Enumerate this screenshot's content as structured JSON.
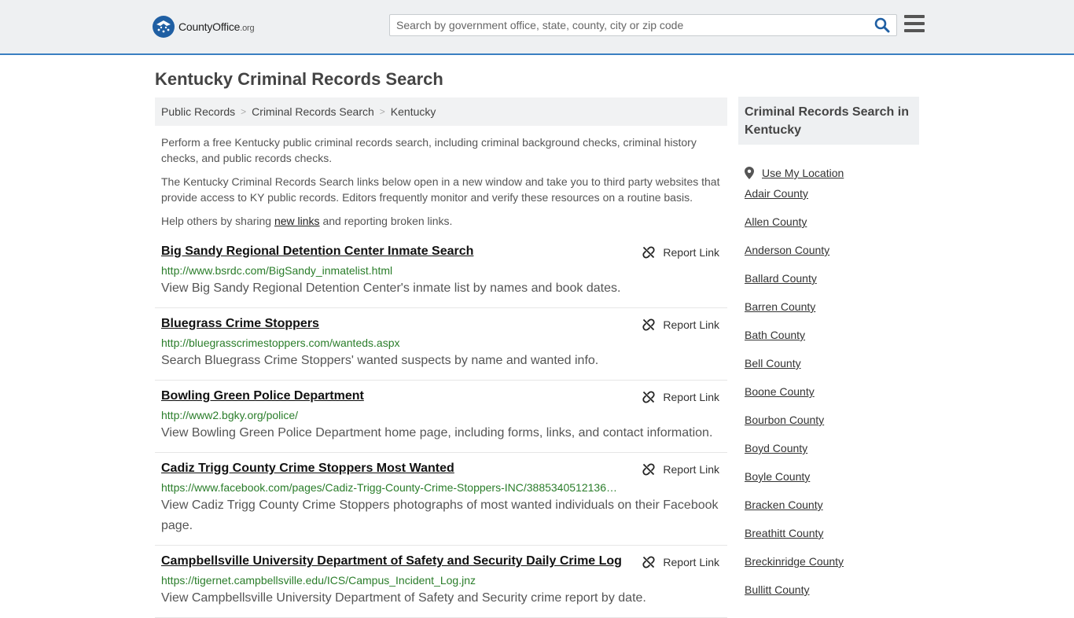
{
  "header": {
    "logo_name": "CountyOffice",
    "logo_suffix": ".org",
    "search_placeholder": "Search by government office, state, county, city or zip code"
  },
  "page_title": "Kentucky Criminal Records Search",
  "breadcrumb": [
    "Public Records",
    "Criminal Records Search",
    "Kentucky"
  ],
  "intro": {
    "p1": "Perform a free Kentucky public criminal records search, including criminal background checks, criminal history checks, and public records checks.",
    "p2": "The Kentucky Criminal Records Search links below open in a new window and take you to third party websites that provide access to KY public records. Editors frequently monitor and verify these resources on a routine basis.",
    "p3_before": "Help others by sharing ",
    "p3_link": "new links",
    "p3_after": " and reporting broken links."
  },
  "report_label": "Report Link",
  "results": [
    {
      "title": "Big Sandy Regional Detention Center Inmate Search",
      "url": "http://www.bsrdc.com/BigSandy_inmatelist.html",
      "desc": "View Big Sandy Regional Detention Center's inmate list by names and book dates."
    },
    {
      "title": "Bluegrass Crime Stoppers",
      "url": "http://bluegrasscrimestoppers.com/wanteds.aspx",
      "desc": "Search Bluegrass Crime Stoppers' wanted suspects by name and wanted info."
    },
    {
      "title": "Bowling Green Police Department",
      "url": "http://www2.bgky.org/police/",
      "desc": "View Bowling Green Police Department home page, including forms, links, and contact information."
    },
    {
      "title": "Cadiz Trigg County Crime Stoppers Most Wanted",
      "url": "https://www.facebook.com/pages/Cadiz-Trigg-County-Crime-Stoppers-INC/3885340512136…",
      "desc": "View Cadiz Trigg County Crime Stoppers photographs of most wanted individuals on their Facebook page."
    },
    {
      "title": "Campbellsville University Department of Safety and Security Daily Crime Log",
      "url": "https://tigernet.campbellsville.edu/ICS/Campus_Incident_Log.jnz",
      "desc": "View Campbellsville University Department of Safety and Security crime report by date."
    }
  ],
  "sidebar": {
    "title": "Criminal Records Search in Kentucky",
    "use_location": "Use My Location",
    "counties": [
      "Adair County",
      "Allen County",
      "Anderson County",
      "Ballard County",
      "Barren County",
      "Bath County",
      "Bell County",
      "Boone County",
      "Bourbon County",
      "Boyd County",
      "Boyle County",
      "Bracken County",
      "Breathitt County",
      "Breckinridge County",
      "Bullitt County"
    ]
  },
  "colors": {
    "accent": "#3a7fc1",
    "url_green": "#2a7d2a",
    "logo_blue": "#1f5fa3"
  }
}
